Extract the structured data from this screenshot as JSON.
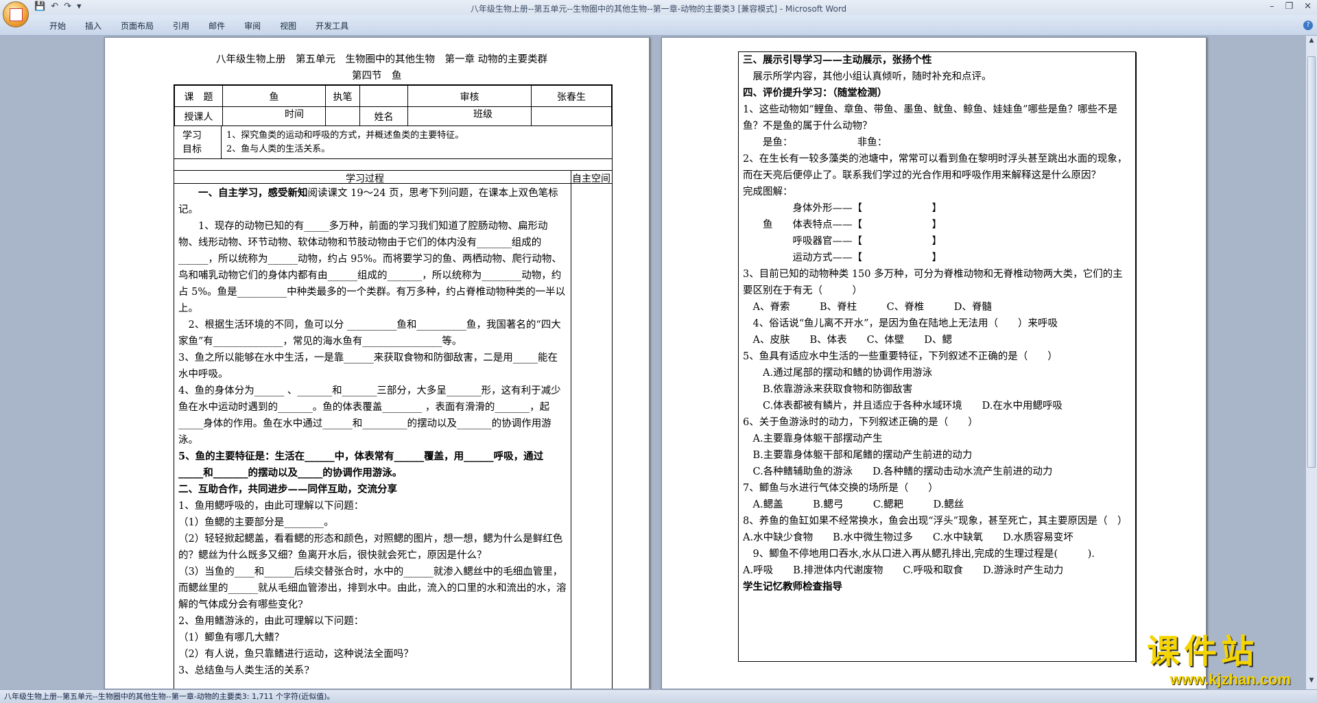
{
  "window": {
    "title": "八年级生物上册--第五单元--生物圈中的其他生物--第一章-动物的主要类3 [兼容模式] - Microsoft Word",
    "controls": [
      "–",
      "❐",
      "✕"
    ]
  },
  "qat": [
    "💾",
    "↶",
    "↷",
    "▾"
  ],
  "ribbon": {
    "tabs": [
      "开始",
      "插入",
      "页面布局",
      "引用",
      "邮件",
      "审阅",
      "视图",
      "开发工具"
    ],
    "help": "?"
  },
  "status": {
    "text": "八年级生物上册--第五单元--生物圈中的其他生物--第一章-动物的主要类3: 1,711 个字符(近似值)。"
  },
  "watermark": {
    "cn": "课件站",
    "url": "www.kjzhan.com"
  },
  "left": {
    "title1": "八年级生物上册　第五单元　生物圈中的其他生物　第一章 动物的主要类群",
    "title2": "第四节　鱼",
    "header": {
      "r1": [
        "课　题",
        "鱼",
        "执笔",
        "",
        "审核",
        "张春生"
      ],
      "r2": [
        "授课人",
        "",
        "时间",
        "",
        "姓名",
        "",
        "班级",
        ""
      ],
      "goal_label": "学习目标",
      "goals": [
        "1、探究鱼类的运动和呼吸的方式，并概述鱼类的主要特征。",
        "2、鱼与人类的生活关系。"
      ],
      "process": "学习过程",
      "space": "自主空间"
    },
    "body": [
      {
        "t": "　　一、自主学习，感受新知",
        "rest": "阅读课文 19～24 页，思考下列问题，在课本上双色笔标记。",
        "b": true
      },
      {
        "t": "　　1、现存的动物已知的有_____多万种，前面的学习我们知道了腔肠动物、扁形动物、线形动物、环节动物、软体动物和节肢动物由于它们的体内没有_______组成的______，所以统称为______动物，约占 95%。而将要学习的鱼、两栖动物、爬行动物、鸟和哺乳动物它们的身体内都有由______组成的_______，所以统称为________动物，约占 5%。鱼是__________中种类最多的一个类群。有万多种，约占脊椎动物种类的一半以上。"
      },
      {
        "t": "　2、根据生活环境的不同，鱼可以分 __________鱼和__________鱼，我国著名的“四大家鱼”有______________，常见的海水鱼有________________等。"
      },
      {
        "t": "3、鱼之所以能够在水中生活，一是靠______来获取食物和防御敌害，二是用_____能在水中呼吸。"
      },
      {
        "t": "4、鱼的身体分为______ 、_______和_______三部分，大多呈_______形，这有利于减少鱼在水中运动时遇到的_______。鱼的体表覆盖________ ，表面有滑滑的_______，起 _____身体的作用。鱼在水中通过______和_________的摆动以及_______的协调作用游泳。"
      },
      {
        "t": "5、鱼的主要特征是：生活在______中，体表常有______覆盖，用______呼吸，通过_____和_______的摆动以及_____的协调作用游泳。",
        "b": true
      },
      {
        "t": "二、互助合作，共同进步——同伴互助，交流分享",
        "b": true
      },
      {
        "t": "1、鱼用鳃呼吸的，由此可理解以下问题："
      },
      {
        "t": "（1）鱼鳃的主要部分是________。"
      },
      {
        "t": "（2）轻轻掀起鳃盖，看看鳃的形态和颜色，对照鳃的图片，想一想，鳃为什么是鲜红色的？鳃丝为什么既多又细？鱼离开水后，很快就会死亡，原因是什么？"
      },
      {
        "t": "（3）当鱼的____和______后续交替张合时，水中的______就渗入鳃丝中的毛细血管里，而鳃丝里的______就从毛细血管渗出，排到水中。由此，流入的口里的水和流出的水，溶解的气体成分会有哪些变化?"
      },
      {
        "t": "2、鱼用鳍游泳的，由此可理解以下问题："
      },
      {
        "t": "（1）鲫鱼有哪几大鳍？"
      },
      {
        "t": "（2）有人说，鱼只靠鳍进行运动，这种说法全面吗？"
      },
      {
        "t": "3、总结鱼与人类生活的关系?"
      }
    ]
  },
  "right": {
    "body": [
      {
        "t": "三、展示引导学习——主动展示，张扬个性",
        "b": true
      },
      {
        "t": "　展示所学内容，其他小组认真倾听，随时补充和点评。"
      },
      {
        "t": "四、评价提升学习：（随堂检测）",
        "b": true
      },
      {
        "t": "1、这些动物如“鲤鱼、章鱼、带鱼、墨鱼、鱿鱼、鲸鱼、娃娃鱼”哪些是鱼？哪些不是鱼？不是鱼的属于什么动物？"
      },
      {
        "t": "　　是鱼：　　　　　　　非鱼："
      },
      {
        "t": "2、在生长有一较多藻类的池塘中，常常可以看到鱼在黎明时浮头甚至跳出水面的现象，而在天亮后便停止了。联系我们学过的光合作用和呼吸作用来解释这是什么原因？"
      },
      {
        "t": "完成图解："
      },
      {
        "t": "　　　　　身体外形——【　　　　　　　】"
      },
      {
        "t": "　　鱼　　体表特点——【　　　　　　　】"
      },
      {
        "t": "　　　　　呼吸器官——【　　　　　　　】"
      },
      {
        "t": "　　　　　运动方式——【　　　　　　　】"
      },
      {
        "t": "3、目前已知的动物种类 150 多万种，可分为脊椎动物和无脊椎动物两大类，它们的主要区别在于有无（　　　）"
      },
      {
        "t": "　A、脊索　　　B、脊柱　　　C、脊椎　　　D、脊髓"
      },
      {
        "t": "　4、俗话说“鱼儿离不开水”，是因为鱼在陆地上无法用（　　）来呼吸"
      },
      {
        "t": "　A、皮肤　　B、体表　　C、体壁　　D、鳃"
      },
      {
        "t": "5、鱼具有适应水中生活的一些重要特征，下列叙述不正确的是（　　）"
      },
      {
        "t": "　　A.通过尾部的摆动和鳍的协调作用游泳"
      },
      {
        "t": "　　B.依靠游泳来获取食物和防御敌害"
      },
      {
        "t": "　　C.体表都被有鳞片，并且适应于各种水域环境　　D.在水中用鳃呼吸"
      },
      {
        "t": "6、关于鱼游泳时的动力，下列叙述正确的是（　　）"
      },
      {
        "t": "　A.主要靠身体躯干部摆动产生"
      },
      {
        "t": "　B.主要靠身体躯干部和尾鳍的摆动产生前进的动力"
      },
      {
        "t": "　C.各种鳍辅助鱼的游泳　　D.各种鳍的摆动击动水流产生前进的动力"
      },
      {
        "t": "7、鲫鱼与水进行气体交换的场所是（　　）"
      },
      {
        "t": "　A.鳃盖　　　B.鳃弓　　　C.鳃耙　　　D.鳃丝"
      },
      {
        "t": "8、养鱼的鱼缸如果不经常换水，鱼会出现“浮头”现象，甚至死亡，其主要原因是（　）"
      },
      {
        "t": "A.水中缺少食物　　B.水中微生物过多　　C.水中缺氧　　D.水质容易变坏"
      },
      {
        "t": "　9、鲫鱼不停地用口吞水,水从口进入再从鳃孔排出,完成的生理过程是(　　　)."
      },
      {
        "t": "A.呼吸　　B.排泄体内代谢废物　　C.呼吸和取食　　D.游泳时产生动力"
      },
      {
        "t": "学生记忆教师检查指导",
        "b": true
      }
    ]
  }
}
